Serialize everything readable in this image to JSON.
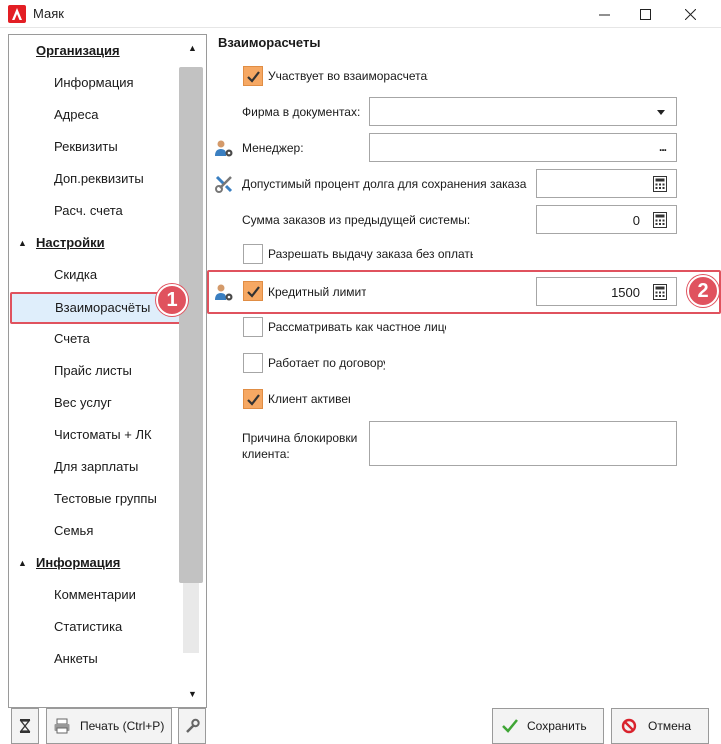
{
  "window": {
    "title": "Маяк"
  },
  "nav": {
    "sections": [
      {
        "label": "Организация",
        "items": [
          "Информация",
          "Адреса",
          "Реквизиты",
          "Доп.реквизиты",
          "Расч. счета"
        ]
      },
      {
        "label": "Настройки",
        "items": [
          "Скидка",
          "Взаиморасчёты",
          "Счета",
          "Прайс листы",
          "Вес услуг",
          "Чистоматы + ЛК",
          "Для зарплаты",
          "Тестовые группы",
          "Семья"
        ]
      },
      {
        "label": "Информация",
        "items": [
          "Комментарии",
          "Статистика",
          "Анкеты"
        ]
      }
    ],
    "selected": "Взаиморасчёты"
  },
  "badges": {
    "one": "1",
    "two": "2"
  },
  "form": {
    "group_title": "Взаиморасчеты",
    "participates_label": "Участвует во взаиморасчетах",
    "participates_checked": true,
    "firm_label": "Фирма в документах:",
    "firm_value": "",
    "manager_label": "Менеджер:",
    "manager_value": "",
    "manager_button": "...",
    "debt_percent_label": "Допустимый процент долга для сохранения заказа:",
    "debt_percent_value": "",
    "prev_orders_label": "Сумма заказов из предыдущей системы:",
    "prev_orders_value": "0",
    "allow_unpaid_label": "Разрешать выдачу заказа без оплаты",
    "allow_unpaid_checked": false,
    "credit_limit_label": "Кредитный лимит",
    "credit_limit_checked": true,
    "credit_limit_value": "1500",
    "private_person_label": "Рассматривать как частное лицо",
    "private_person_checked": false,
    "contract_label": "Работает по договору",
    "contract_checked": false,
    "active_label": "Клиент активен",
    "active_checked": true,
    "block_reason_label": "Причина блокировки клиента:",
    "block_reason_value": ""
  },
  "toolbar": {
    "print_label": "Печать (Ctrl+P)",
    "save_label": "Сохранить",
    "cancel_label": "Отмена"
  },
  "colors": {
    "accent_red": "#e0525e",
    "check_orange": "#f6a863",
    "selected_bg": "#dfeefb",
    "save_green": "#3fa535",
    "cancel_red": "#d9232d"
  }
}
